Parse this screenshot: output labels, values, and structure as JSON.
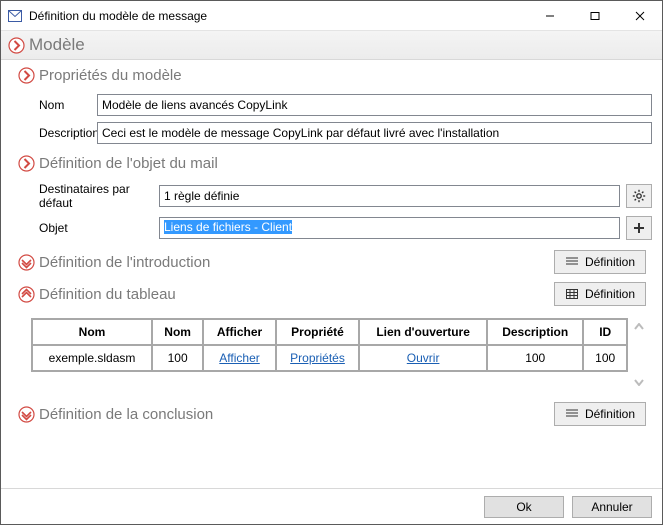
{
  "window": {
    "title": "Définition du modèle de message",
    "minimize": "–",
    "maximize": "☐",
    "close": "✕"
  },
  "sections": {
    "main": "Modèle",
    "props": "Propriétés du modèle",
    "maildef": "Définition de l'objet du mail",
    "intro": "Définition de l'introduction",
    "table": "Définition du tableau",
    "conclusion": "Définition de la conclusion"
  },
  "labels": {
    "nom": "Nom",
    "description": "Description",
    "recipients": "Destinataires par défaut",
    "objet": "Objet",
    "definition": "Définition"
  },
  "values": {
    "nom": "Modèle de liens avancés CopyLink",
    "description": "Ceci est le modèle de message CopyLink par défaut livré avec l'installation",
    "recipients": "1 règle définie",
    "objet": "Liens de fichiers - Client"
  },
  "table": {
    "headers": [
      "Nom",
      "Nom",
      "Afficher",
      "Propriété",
      "Lien d'ouverture",
      "Description",
      "ID"
    ],
    "row": {
      "c0": "exemple.sldasm",
      "c1": "100",
      "c2": "Afficher",
      "c3": "Propriétés",
      "c4": "Ouvrir",
      "c5": "100",
      "c6": "100"
    }
  },
  "footer": {
    "ok": "Ok",
    "cancel": "Annuler"
  }
}
